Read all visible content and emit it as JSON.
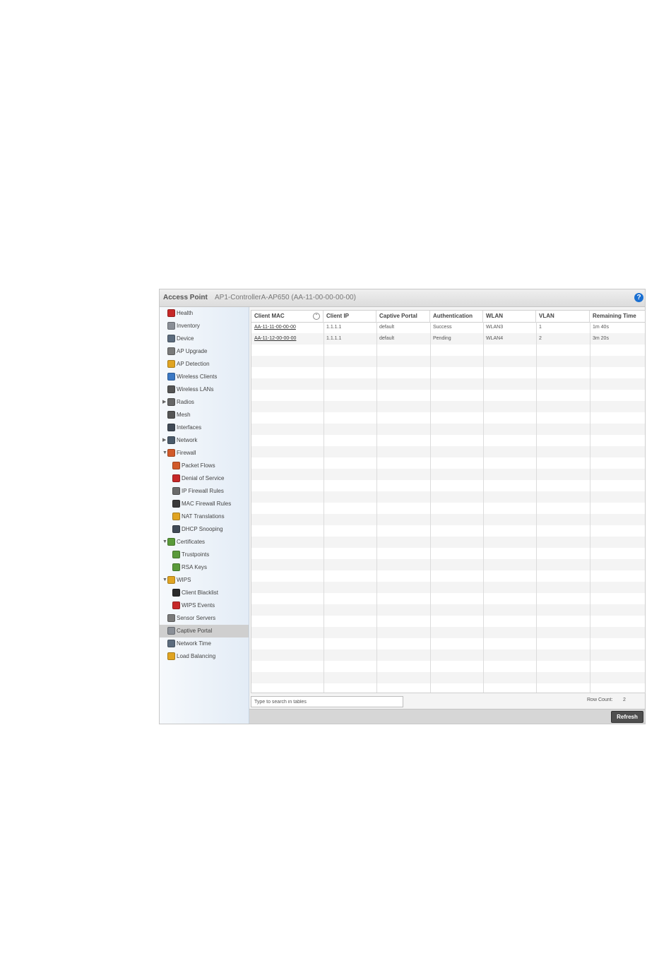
{
  "header": {
    "label": "Access Point",
    "device": "AP1-ControllerA-AP650 (AA-11-00-00-00-00)",
    "help": "?"
  },
  "sidebar": {
    "items": [
      {
        "label": "Health",
        "icon": "health-icon",
        "color": "#c62828"
      },
      {
        "label": "Inventory",
        "icon": "inventory-icon",
        "color": "#8a8f97"
      },
      {
        "label": "Device",
        "icon": "device-icon",
        "color": "#5c6c7e"
      },
      {
        "label": "AP Upgrade",
        "icon": "ap-upgrade-icon",
        "color": "#7a7a7a"
      },
      {
        "label": "AP Detection",
        "icon": "ap-detection-icon",
        "color": "#e0a422"
      },
      {
        "label": "Wireless Clients",
        "icon": "wireless-clients-icon",
        "color": "#3b78c4"
      },
      {
        "label": "Wireless LANs",
        "icon": "wireless-lans-icon",
        "color": "#555555"
      },
      {
        "label": "Radios",
        "icon": "radios-icon",
        "color": "#666666",
        "arrow": "▶"
      },
      {
        "label": "Mesh",
        "icon": "mesh-icon",
        "color": "#555555"
      },
      {
        "label": "Interfaces",
        "icon": "interfaces-icon",
        "color": "#404a56"
      },
      {
        "label": "Network",
        "icon": "network-icon",
        "color": "#4a5a6a",
        "arrow": "▶"
      },
      {
        "label": "Firewall",
        "icon": "firewall-icon",
        "color": "#d15a2a",
        "arrow": "▼"
      },
      {
        "label": "Packet Flows",
        "icon": "packet-flows-icon",
        "color": "#d15a2a",
        "indent": true
      },
      {
        "label": "Denial of Service",
        "icon": "denial-of-service-icon",
        "color": "#c62828",
        "indent": true
      },
      {
        "label": "IP Firewall Rules",
        "icon": "ip-firewall-rules-icon",
        "color": "#6a6a6a",
        "indent": true
      },
      {
        "label": "MAC Firewall Rules",
        "icon": "mac-firewall-rules-icon",
        "color": "#3a3a3a",
        "indent": true
      },
      {
        "label": "NAT Translations",
        "icon": "nat-translations-icon",
        "color": "#e0a422",
        "indent": true
      },
      {
        "label": "DHCP Snooping",
        "icon": "dhcp-snooping-icon",
        "color": "#404a56",
        "indent": true
      },
      {
        "label": "Certificates",
        "icon": "certificates-icon",
        "color": "#5a9a3a",
        "arrow": "▼"
      },
      {
        "label": "Trustpoints",
        "icon": "trustpoints-icon",
        "color": "#5a9a3a",
        "indent": true
      },
      {
        "label": "RSA Keys",
        "icon": "rsa-keys-icon",
        "color": "#5a9a3a",
        "indent": true
      },
      {
        "label": "WIPS",
        "icon": "wips-icon",
        "color": "#e0a422",
        "arrow": "▼"
      },
      {
        "label": "Client Blacklist",
        "icon": "client-blacklist-icon",
        "color": "#2a2a2a",
        "indent": true
      },
      {
        "label": "WIPS Events",
        "icon": "wips-events-icon",
        "color": "#c62828",
        "indent": true
      },
      {
        "label": "Sensor Servers",
        "icon": "sensor-servers-icon",
        "color": "#7a7a7a"
      },
      {
        "label": "Captive Portal",
        "icon": "captive-portal-icon",
        "color": "#8a8f97",
        "active": true
      },
      {
        "label": "Network Time",
        "icon": "network-time-icon",
        "color": "#5c6c7e"
      },
      {
        "label": "Load Balancing",
        "icon": "load-balancing-icon",
        "color": "#e0a422"
      }
    ]
  },
  "table": {
    "columns": [
      "Client MAC",
      "Client IP",
      "Captive Portal",
      "Authentication",
      "WLAN",
      "VLAN",
      "Remaining Time"
    ],
    "sort_icon": "sort-icon",
    "rows": [
      [
        "AA-11-11-00-00-00",
        "1.1.1.1",
        "default",
        "Success",
        "WLAN3",
        "1",
        "1m 40s"
      ],
      [
        "AA-11-12-00-00-00",
        "1.1.1.1",
        "default",
        "Pending",
        "WLAN4",
        "2",
        "3m 20s"
      ]
    ]
  },
  "search": {
    "placeholder": "Type to search in tables"
  },
  "row_count": {
    "label": "Row Count:",
    "value": "2"
  },
  "footer": {
    "refresh_label": "Refresh"
  }
}
